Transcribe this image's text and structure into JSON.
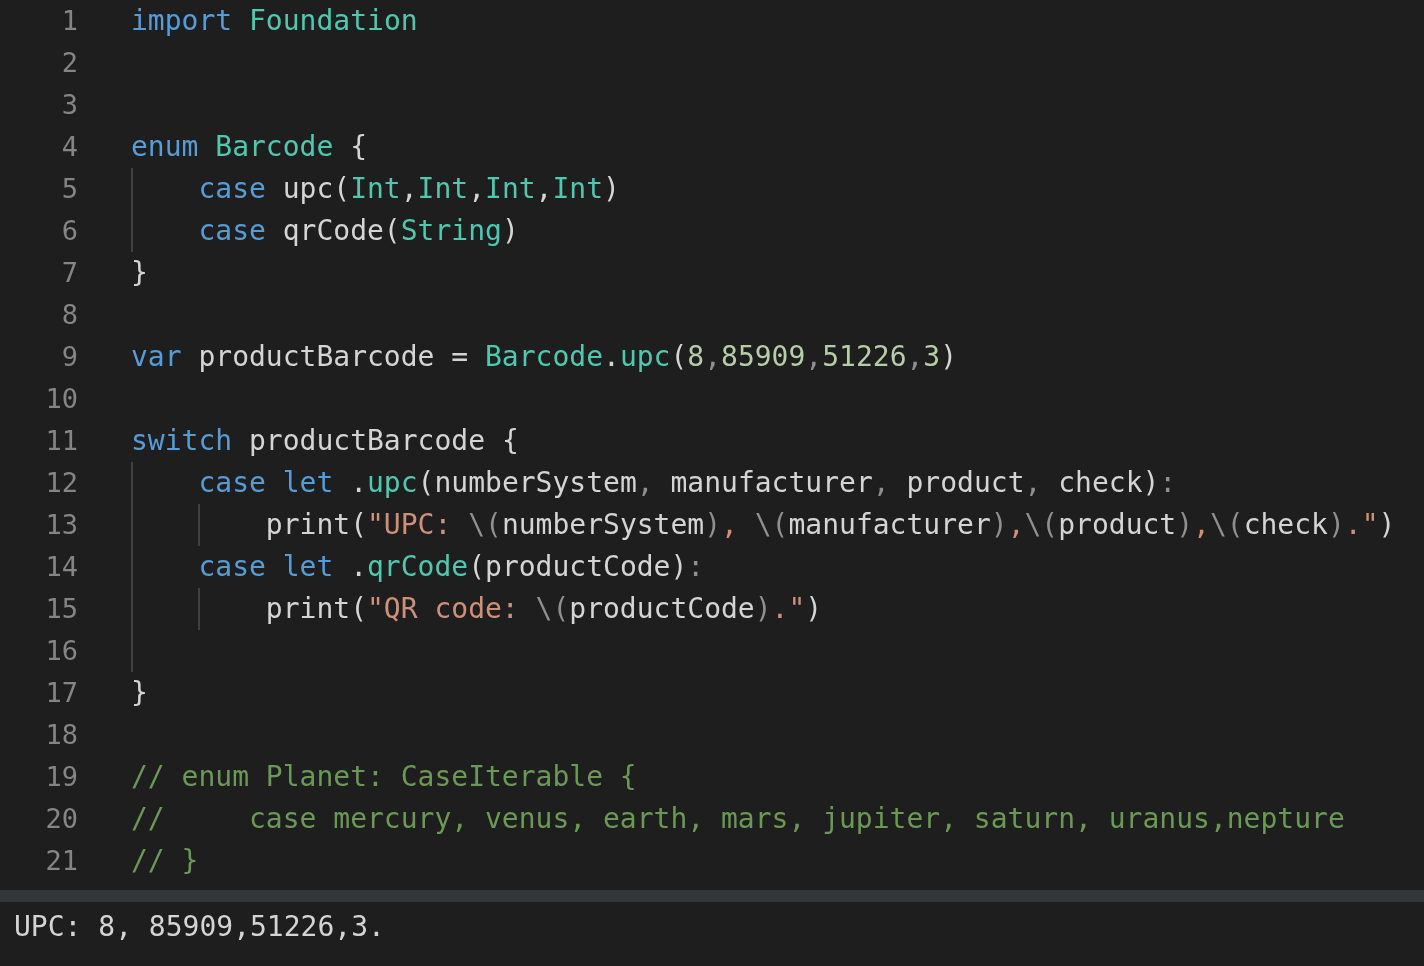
{
  "editor": {
    "lines": [
      {
        "number": "1",
        "tokens": [
          {
            "kind": "keyword",
            "text": "import "
          },
          {
            "kind": "type",
            "text": "Foundation"
          }
        ]
      },
      {
        "number": "2"
      },
      {
        "number": "3"
      },
      {
        "number": "4",
        "tokens": [
          {
            "kind": "keyword",
            "text": "enum "
          },
          {
            "kind": "type",
            "text": "Barcode"
          },
          {
            "kind": "text",
            "text": " {"
          }
        ]
      },
      {
        "number": "5",
        "tokens": [
          {
            "kind": "indent"
          },
          {
            "kind": "keyword",
            "text": "case"
          },
          {
            "kind": "text",
            "text": " upc("
          },
          {
            "kind": "type",
            "text": "Int"
          },
          {
            "kind": "text",
            "text": ","
          },
          {
            "kind": "type",
            "text": "Int"
          },
          {
            "kind": "text",
            "text": ","
          },
          {
            "kind": "type",
            "text": "Int"
          },
          {
            "kind": "text",
            "text": ","
          },
          {
            "kind": "type",
            "text": "Int"
          },
          {
            "kind": "text",
            "text": ")"
          }
        ]
      },
      {
        "number": "6",
        "tokens": [
          {
            "kind": "indent"
          },
          {
            "kind": "keyword",
            "text": "case"
          },
          {
            "kind": "text",
            "text": " qrCode("
          },
          {
            "kind": "type",
            "text": "String"
          },
          {
            "kind": "text",
            "text": ")"
          }
        ]
      },
      {
        "number": "7",
        "tokens": [
          {
            "kind": "text",
            "text": "}"
          }
        ]
      },
      {
        "number": "8"
      },
      {
        "number": "9",
        "tokens": [
          {
            "kind": "keyword",
            "text": "var"
          },
          {
            "kind": "text",
            "text": " productBarcode = "
          },
          {
            "kind": "type",
            "text": "Barcode"
          },
          {
            "kind": "text",
            "text": "."
          },
          {
            "kind": "type",
            "text": "upc"
          },
          {
            "kind": "text",
            "text": "("
          },
          {
            "kind": "number",
            "text": "8"
          },
          {
            "kind": "punct",
            "text": ","
          },
          {
            "kind": "number",
            "text": "85909"
          },
          {
            "kind": "punct",
            "text": ","
          },
          {
            "kind": "number",
            "text": "51226"
          },
          {
            "kind": "punct",
            "text": ","
          },
          {
            "kind": "number",
            "text": "3"
          },
          {
            "kind": "text",
            "text": ")"
          }
        ]
      },
      {
        "number": "10"
      },
      {
        "number": "11",
        "tokens": [
          {
            "kind": "keyword",
            "text": "switch"
          },
          {
            "kind": "text",
            "text": " productBarcode {"
          }
        ]
      },
      {
        "number": "12",
        "tokens": [
          {
            "kind": "indent"
          },
          {
            "kind": "keyword",
            "text": "case "
          },
          {
            "kind": "keyword",
            "text": "let"
          },
          {
            "kind": "text",
            "text": " ."
          },
          {
            "kind": "type",
            "text": "upc"
          },
          {
            "kind": "text",
            "text": "(numberSystem"
          },
          {
            "kind": "punct",
            "text": ","
          },
          {
            "kind": "text",
            "text": " manufacturer"
          },
          {
            "kind": "punct",
            "text": ","
          },
          {
            "kind": "text",
            "text": " product"
          },
          {
            "kind": "punct",
            "text": ","
          },
          {
            "kind": "text",
            "text": " check)"
          },
          {
            "kind": "punct",
            "text": ":"
          }
        ]
      },
      {
        "number": "13",
        "tokens": [
          {
            "kind": "indent"
          },
          {
            "kind": "indent"
          },
          {
            "kind": "text",
            "text": "print("
          },
          {
            "kind": "string",
            "text": "\"UPC: "
          },
          {
            "kind": "punct",
            "text": "\\("
          },
          {
            "kind": "text",
            "text": "numberSystem"
          },
          {
            "kind": "punct",
            "text": ")"
          },
          {
            "kind": "string",
            "text": ", "
          },
          {
            "kind": "punct",
            "text": "\\("
          },
          {
            "kind": "text",
            "text": "manufacturer"
          },
          {
            "kind": "punct",
            "text": ")"
          },
          {
            "kind": "string",
            "text": ","
          },
          {
            "kind": "punct",
            "text": "\\("
          },
          {
            "kind": "text",
            "text": "product"
          },
          {
            "kind": "punct",
            "text": ")"
          },
          {
            "kind": "string",
            "text": ","
          },
          {
            "kind": "punct",
            "text": "\\("
          },
          {
            "kind": "text",
            "text": "check"
          },
          {
            "kind": "punct",
            "text": ")"
          },
          {
            "kind": "string",
            "text": ".\""
          },
          {
            "kind": "text",
            "text": ")"
          }
        ]
      },
      {
        "number": "14",
        "tokens": [
          {
            "kind": "indent"
          },
          {
            "kind": "keyword",
            "text": "case "
          },
          {
            "kind": "keyword",
            "text": "let"
          },
          {
            "kind": "text",
            "text": " ."
          },
          {
            "kind": "type",
            "text": "qrCode"
          },
          {
            "kind": "text",
            "text": "(productCode)"
          },
          {
            "kind": "punct",
            "text": ":"
          }
        ]
      },
      {
        "number": "15",
        "tokens": [
          {
            "kind": "indent"
          },
          {
            "kind": "indent"
          },
          {
            "kind": "text",
            "text": "print("
          },
          {
            "kind": "string",
            "text": "\"QR code: "
          },
          {
            "kind": "punct",
            "text": "\\("
          },
          {
            "kind": "text",
            "text": "productCode"
          },
          {
            "kind": "punct",
            "text": ")"
          },
          {
            "kind": "string",
            "text": ".\""
          },
          {
            "kind": "text",
            "text": ")"
          }
        ]
      },
      {
        "number": "16",
        "tokens": [
          {
            "kind": "indent"
          }
        ]
      },
      {
        "number": "17",
        "tokens": [
          {
            "kind": "text",
            "text": "}"
          }
        ]
      },
      {
        "number": "18"
      },
      {
        "number": "19",
        "tokens": [
          {
            "kind": "comment",
            "text": "// enum Planet: CaseIterable {"
          }
        ]
      },
      {
        "number": "20",
        "tokens": [
          {
            "kind": "comment",
            "text": "//     case mercury, venus, earth, mars, jupiter, saturn, uranus,nepture"
          }
        ]
      },
      {
        "number": "21",
        "tokens": [
          {
            "kind": "comment",
            "text": "// }"
          }
        ]
      }
    ]
  },
  "console": {
    "output": "UPC: 8, 85909,51226,3."
  }
}
